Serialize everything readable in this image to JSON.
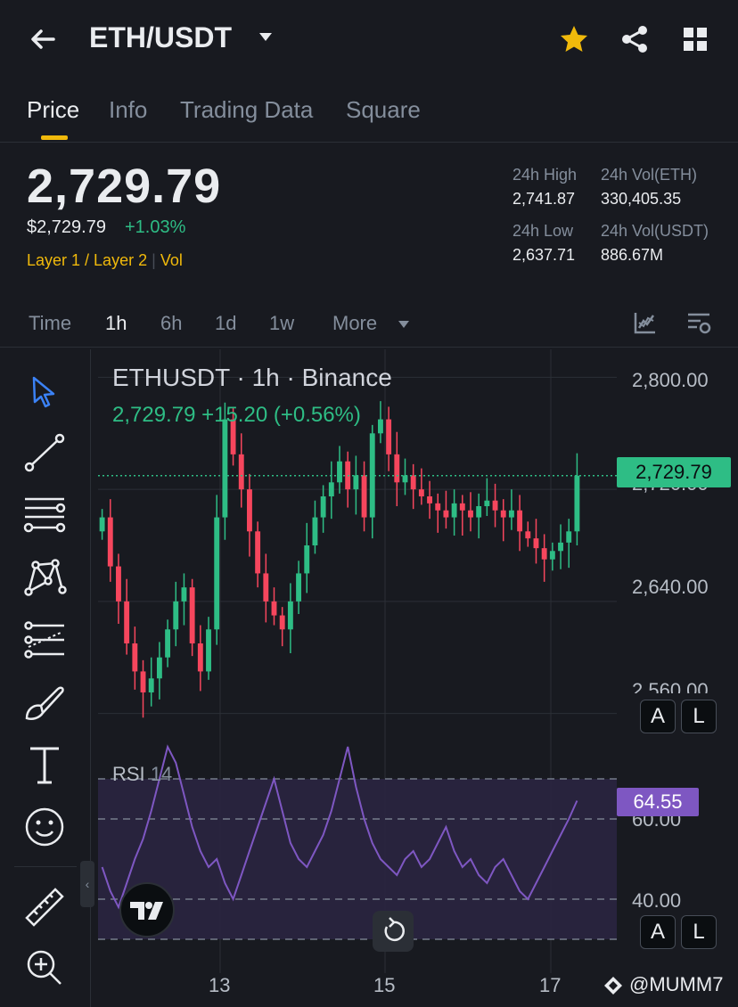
{
  "header": {
    "pair": "ETH/USDT",
    "icons": [
      "back-arrow-icon",
      "caret-down-icon",
      "star-icon",
      "share-icon",
      "grid-icon"
    ],
    "star_color": "#f0b90b"
  },
  "tabs": [
    {
      "label": "Price",
      "active": true
    },
    {
      "label": "Info",
      "active": false
    },
    {
      "label": "Trading Data",
      "active": false
    },
    {
      "label": "Square",
      "active": false
    }
  ],
  "price": {
    "last": "2,729.79",
    "usd": "$2,729.79",
    "change_pct": "+1.03%",
    "tag1": "Layer 1 / Layer 2",
    "tag_sep": "|",
    "tag2": "Vol"
  },
  "stats": {
    "high_label": "24h High",
    "high_value": "2,741.87",
    "low_label": "24h Low",
    "low_value": "2,637.71",
    "vol_eth_label": "24h Vol(ETH)",
    "vol_eth_value": "330,405.35",
    "vol_usdt_label": "24h Vol(USDT)",
    "vol_usdt_value": "886.67M"
  },
  "intervals": {
    "items": [
      "Time",
      "1h",
      "6h",
      "1d",
      "1w",
      "More"
    ],
    "active": "1h"
  },
  "chart": {
    "title": "ETHUSDT · 1h · Binance",
    "subtitle": "2,729.79  +15.20 (+0.56%)",
    "price_axis": [
      "2,800.00",
      "2,720.00",
      "2,640.00",
      "2,560.00"
    ],
    "last_price_label": "2,729.79",
    "rsi_title": "RSI",
    "rsi_length": "14",
    "rsi_value_label": "64.55",
    "rsi_axis": [
      "60.00",
      "40.00"
    ],
    "date_labels": [
      "13",
      "15",
      "17"
    ],
    "btn_a": "A",
    "btn_l": "L",
    "up_color": "#2ebd85",
    "down_color": "#f6465d",
    "rsi_color": "#7e57c2"
  },
  "chart_data": {
    "type": "candlestick",
    "symbol": "ETHUSDT",
    "interval": "1h",
    "exchange": "Binance",
    "ylim": [
      2540,
      2820
    ],
    "last_price": 2729.79,
    "x_ticks": [
      "13",
      "15",
      "17"
    ],
    "close_series": [
      2700,
      2665,
      2640,
      2610,
      2590,
      2575,
      2585,
      2600,
      2620,
      2640,
      2650,
      2610,
      2590,
      2620,
      2700,
      2770,
      2745,
      2720,
      2690,
      2660,
      2640,
      2630,
      2620,
      2640,
      2660,
      2680,
      2700,
      2715,
      2725,
      2740,
      2720,
      2730,
      2700,
      2760,
      2770,
      2745,
      2725,
      2730,
      2720,
      2715,
      2710,
      2705,
      2700,
      2710,
      2705,
      2700,
      2708,
      2712,
      2705,
      2700,
      2705,
      2690,
      2685,
      2678,
      2670,
      2676,
      2682,
      2690,
      2729.79
    ],
    "rsi": {
      "period": 14,
      "value": 64.55,
      "levels": [
        70,
        60,
        40,
        30
      ],
      "series": [
        48,
        42,
        38,
        44,
        50,
        55,
        62,
        70,
        78,
        74,
        66,
        58,
        52,
        48,
        50,
        44,
        40,
        46,
        52,
        58,
        64,
        70,
        62,
        54,
        50,
        48,
        52,
        56,
        62,
        70,
        78,
        68,
        60,
        54,
        50,
        48,
        46,
        50,
        52,
        48,
        50,
        54,
        58,
        52,
        48,
        50,
        46,
        44,
        48,
        50,
        46,
        42,
        40,
        44,
        48,
        52,
        56,
        60,
        64.55
      ]
    }
  },
  "watermark": "@MUMM7"
}
